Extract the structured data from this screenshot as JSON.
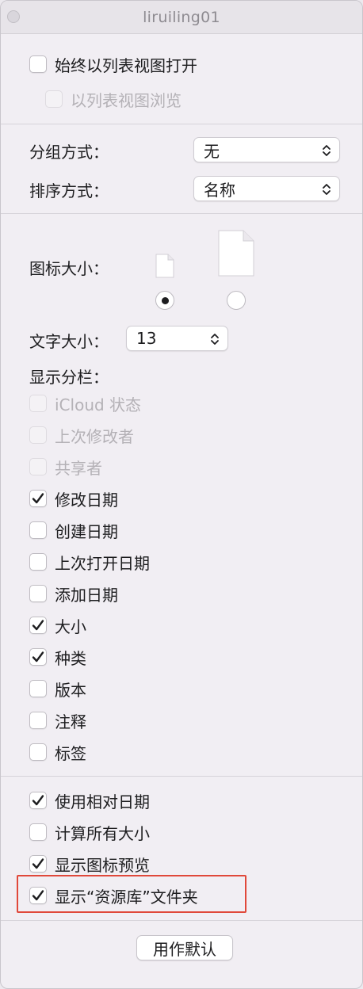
{
  "window": {
    "title": "liruiling01"
  },
  "section1": {
    "always_list": {
      "label": "始终以列表视图打开",
      "checked": false,
      "disabled": false
    },
    "browse_list": {
      "label": "以列表视图浏览",
      "checked": false,
      "disabled": true
    }
  },
  "section2": {
    "group_by": {
      "label": "分组方式：",
      "value": "无"
    },
    "sort_by": {
      "label": "排序方式：",
      "value": "名称"
    }
  },
  "section3": {
    "icon_size": {
      "label": "图标大小：",
      "options": [
        "small-document-icon",
        "large-document-icon"
      ],
      "selected": 0
    },
    "text_size": {
      "label": "文字大小：",
      "value": "13"
    },
    "columns_label": "显示分栏：",
    "columns": [
      {
        "label": "iCloud 状态",
        "checked": false,
        "disabled": true
      },
      {
        "label": "上次修改者",
        "checked": false,
        "disabled": true
      },
      {
        "label": "共享者",
        "checked": false,
        "disabled": true
      },
      {
        "label": "修改日期",
        "checked": true,
        "disabled": false
      },
      {
        "label": "创建日期",
        "checked": false,
        "disabled": false
      },
      {
        "label": "上次打开日期",
        "checked": false,
        "disabled": false
      },
      {
        "label": "添加日期",
        "checked": false,
        "disabled": false
      },
      {
        "label": "大小",
        "checked": true,
        "disabled": false
      },
      {
        "label": "种类",
        "checked": true,
        "disabled": false
      },
      {
        "label": "版本",
        "checked": false,
        "disabled": false
      },
      {
        "label": "注释",
        "checked": false,
        "disabled": false
      },
      {
        "label": "标签",
        "checked": false,
        "disabled": false
      }
    ]
  },
  "section4": {
    "options": [
      {
        "label": "使用相对日期",
        "checked": true,
        "disabled": false
      },
      {
        "label": "计算所有大小",
        "checked": false,
        "disabled": false
      },
      {
        "label": "显示图标预览",
        "checked": true,
        "disabled": false
      },
      {
        "label": "显示“资源库”文件夹",
        "checked": true,
        "disabled": false
      }
    ]
  },
  "footer": {
    "default_button_label": "用作默认"
  },
  "colors": {
    "highlight": "#e0483a",
    "window_bg": "#f1eef3"
  }
}
